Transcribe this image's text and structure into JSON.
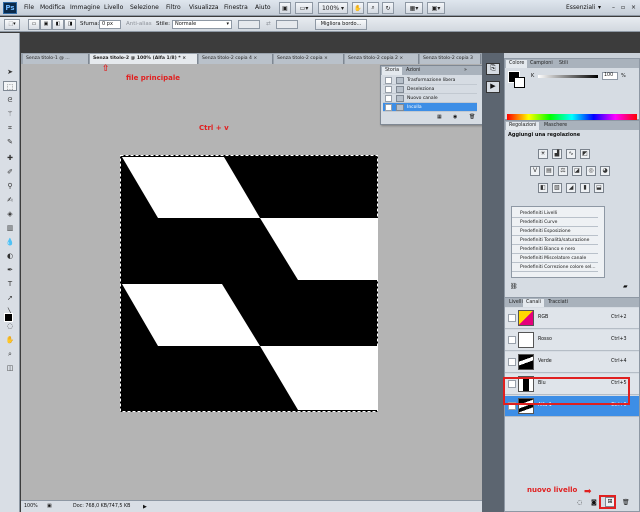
{
  "app": {
    "logo": "Ps",
    "workspace": "Essenziali"
  },
  "menu": [
    "File",
    "Modifica",
    "Immagine",
    "Livello",
    "Selezione",
    "Filtro",
    "Visualizza",
    "Finestra",
    "Aiuto"
  ],
  "menubar": {
    "zoom": "100%"
  },
  "options": {
    "sfuma_label": "Sfuma:",
    "sfuma_value": "0 px",
    "antialias_label": "Anti-alias",
    "stile_label": "Stile:",
    "stile_value": "Normale",
    "refine_label": "Migliora bordo..."
  },
  "tabs": [
    {
      "label": "Senza titolo-1 @ ..."
    },
    {
      "label": "Senza titolo-2 @ 100% (Alfa 1/8) * ×"
    },
    {
      "label": "Senza titolo-2 copia 4 ×"
    },
    {
      "label": "Senza titolo-2 copia ×"
    },
    {
      "label": "Senza titolo-2 copia 2 ×"
    },
    {
      "label": "Senza titolo-2 copia 3"
    }
  ],
  "annotations": {
    "main_file": "file principale",
    "paste": "Ctrl + v",
    "new_layer": "nuovo livello"
  },
  "history_panel": {
    "tabs": [
      "Storia",
      "Azioni"
    ],
    "items": [
      {
        "label": "Trasformazione libera",
        "selected": false
      },
      {
        "label": "Deseleziona",
        "selected": false
      },
      {
        "label": "Nuovo canale",
        "selected": false
      },
      {
        "label": "Incolla",
        "selected": true
      }
    ]
  },
  "color_panel": {
    "tabs": [
      "Colore",
      "Campioni",
      "Stili"
    ],
    "k_label": "K",
    "k_value": "100",
    "k_unit": "%"
  },
  "adjustments_panel": {
    "tabs": [
      "Regolazioni",
      "Maschere"
    ],
    "title": "Aggiungi una regolazione",
    "presets": [
      "Predefiniti Livelli",
      "Predefiniti Curve",
      "Predefiniti Esposizione",
      "Predefiniti Tonalità/saturazione",
      "Predefiniti Bianco e nero",
      "Predefiniti Miscelatore canale",
      "Predefiniti Correzione colore sel..."
    ]
  },
  "channels_panel": {
    "tabs": [
      "Livelli",
      "Canali",
      "Tracciati"
    ],
    "channels": [
      {
        "name": "RGB",
        "shortcut": "Ctrl+2",
        "selected": false
      },
      {
        "name": "Rosso",
        "shortcut": "Ctrl+3",
        "selected": false
      },
      {
        "name": "Verde",
        "shortcut": "Ctrl+4",
        "selected": false
      },
      {
        "name": "Blu",
        "shortcut": "Ctrl+5",
        "selected": false
      },
      {
        "name": "Alfa 1",
        "shortcut": "Ctrl+6",
        "selected": true
      }
    ]
  },
  "status": {
    "zoom": "100%",
    "doc": "Doc: 768,0 KB/747,5 KB"
  },
  "colors": {
    "selection_blue": "#3d8ee6",
    "annotation_red": "#e02020",
    "canvas_bg": "#b4b4b4"
  },
  "icons": [
    "move-icon",
    "marquee-icon",
    "lasso-icon",
    "wand-icon",
    "crop-icon",
    "eyedropper-icon",
    "heal-icon",
    "brush-icon",
    "stamp-icon",
    "history-brush-icon",
    "eraser-icon",
    "gradient-icon",
    "blur-icon",
    "dodge-icon",
    "pen-icon",
    "type-icon",
    "path-select-icon",
    "shape-icon",
    "3d-icon",
    "hand-icon",
    "zoom-icon",
    "color-swatch-icon",
    "quickmask-icon",
    "new-channel-icon",
    "trash-icon",
    "arrow-up-icon",
    "arrow-right-icon"
  ]
}
